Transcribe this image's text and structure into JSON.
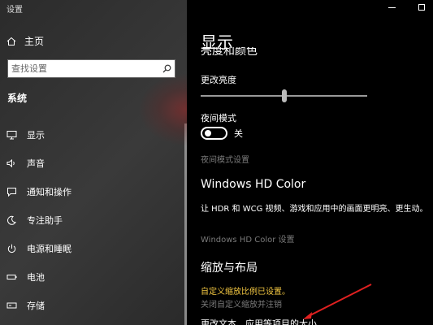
{
  "window": {
    "title": "设置"
  },
  "sidebar": {
    "home_label": "主页",
    "search_placeholder": "查找设置",
    "section_label": "系统",
    "items": [
      {
        "label": "显示",
        "icon": "monitor-icon"
      },
      {
        "label": "声音",
        "icon": "speaker-icon"
      },
      {
        "label": "通知和操作",
        "icon": "notification-icon"
      },
      {
        "label": "专注助手",
        "icon": "moon-icon"
      },
      {
        "label": "电源和睡眠",
        "icon": "power-icon"
      },
      {
        "label": "电池",
        "icon": "battery-icon"
      },
      {
        "label": "存储",
        "icon": "storage-icon"
      }
    ]
  },
  "main": {
    "title": "显示",
    "clipped_heading": "亮度和颜色",
    "brightness_label": "更改亮度",
    "brightness_value": 0.5,
    "night_mode_label": "夜间模式",
    "night_mode_state": "关",
    "night_mode_settings_link": "夜间模式设置",
    "hd_color_heading": "Windows HD Color",
    "hd_color_desc": "让 HDR 和 WCG 视频、游戏和应用中的画面更明亮、更生动。",
    "hd_color_link": "Windows HD Color 设置",
    "scale_heading": "缩放与布局",
    "custom_scale_warning": "自定义缩放比例已设置。",
    "custom_scale_off_link": "关闭自定义缩放并注销",
    "cutoff_label": "更改文本、应用等项目的大小"
  },
  "colors": {
    "warning": "#f4c842",
    "accent_annotation": "#e02020"
  }
}
